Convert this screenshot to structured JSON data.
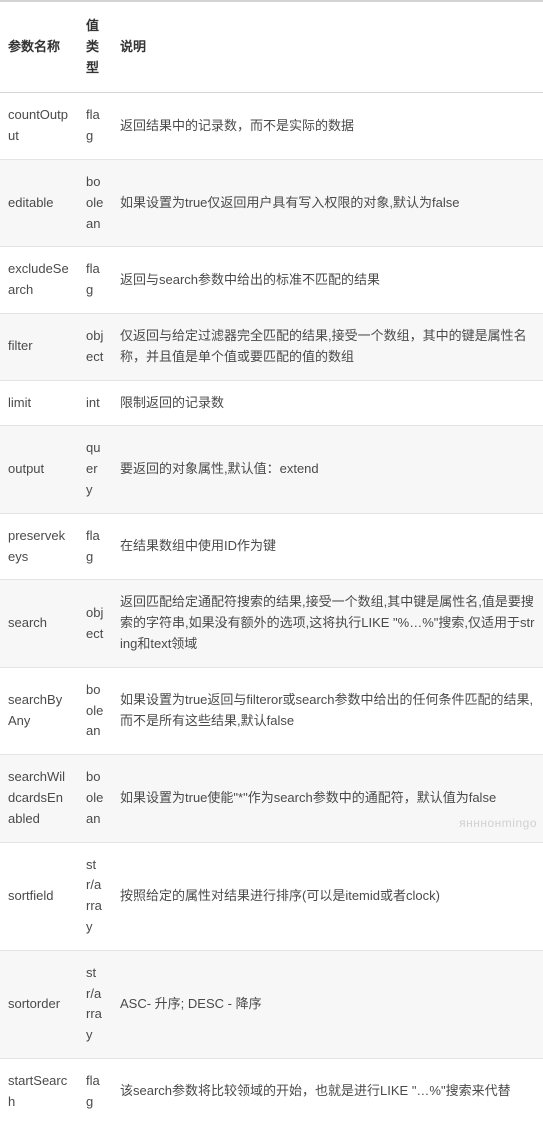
{
  "columns": [
    "参数名称",
    "值类型",
    "说明"
  ],
  "rows": [
    {
      "name": "countOutput",
      "type": "flag",
      "desc": "返回结果中的记录数，而不是实际的数据"
    },
    {
      "name": "editable",
      "type": "boolean",
      "desc": "如果设置为true仅返回用户具有写入权限的对象,默认为false"
    },
    {
      "name": "excludeSearch",
      "type": "flag",
      "desc": "返回与search参数中给出的标准不匹配的结果"
    },
    {
      "name": "filter",
      "type": "object",
      "desc": "仅返回与给定过滤器完全匹配的结果,接受一个数组，其中的键是属性名称，并且值是单个值或要匹配的值的数组"
    },
    {
      "name": "limit",
      "type": "int",
      "desc": "限制返回的记录数"
    },
    {
      "name": "output",
      "type": "query",
      "desc": "要返回的对象属性,默认值：extend"
    },
    {
      "name": "preservekeys",
      "type": "flag",
      "desc": "在结果数组中使用ID作为键"
    },
    {
      "name": "search",
      "type": "object",
      "desc": "返回匹配给定通配符搜索的结果,接受一个数组,其中键是属性名,值是要搜索的字符串,如果没有额外的选项,这将执行LIKE \"%…%\"搜索,仅适用于string和text领域"
    },
    {
      "name": "searchByAny",
      "type": "boolean",
      "desc": "如果设置为true返回与filteror或search参数中给出的任何条件匹配的结果,而不是所有这些结果,默认false"
    },
    {
      "name": "searchWildcardsEnabled",
      "type": "boolean",
      "desc": "如果设置为true使能\"*\"作为search参数中的通配符，默认值为false"
    },
    {
      "name": "sortfield",
      "type": "str/array",
      "desc": "按照给定的属性对结果进行排序(可以是itemid或者clock)"
    },
    {
      "name": "sortorder",
      "type": "str/array",
      "desc": "ASC- 升序; DESC - 降序"
    },
    {
      "name": "startSearch",
      "type": "flag",
      "desc": "该search参数将比较领域的开始，也就是进行LIKE \"…%\"搜索来代替"
    }
  ],
  "watermark": "янннонmingo"
}
